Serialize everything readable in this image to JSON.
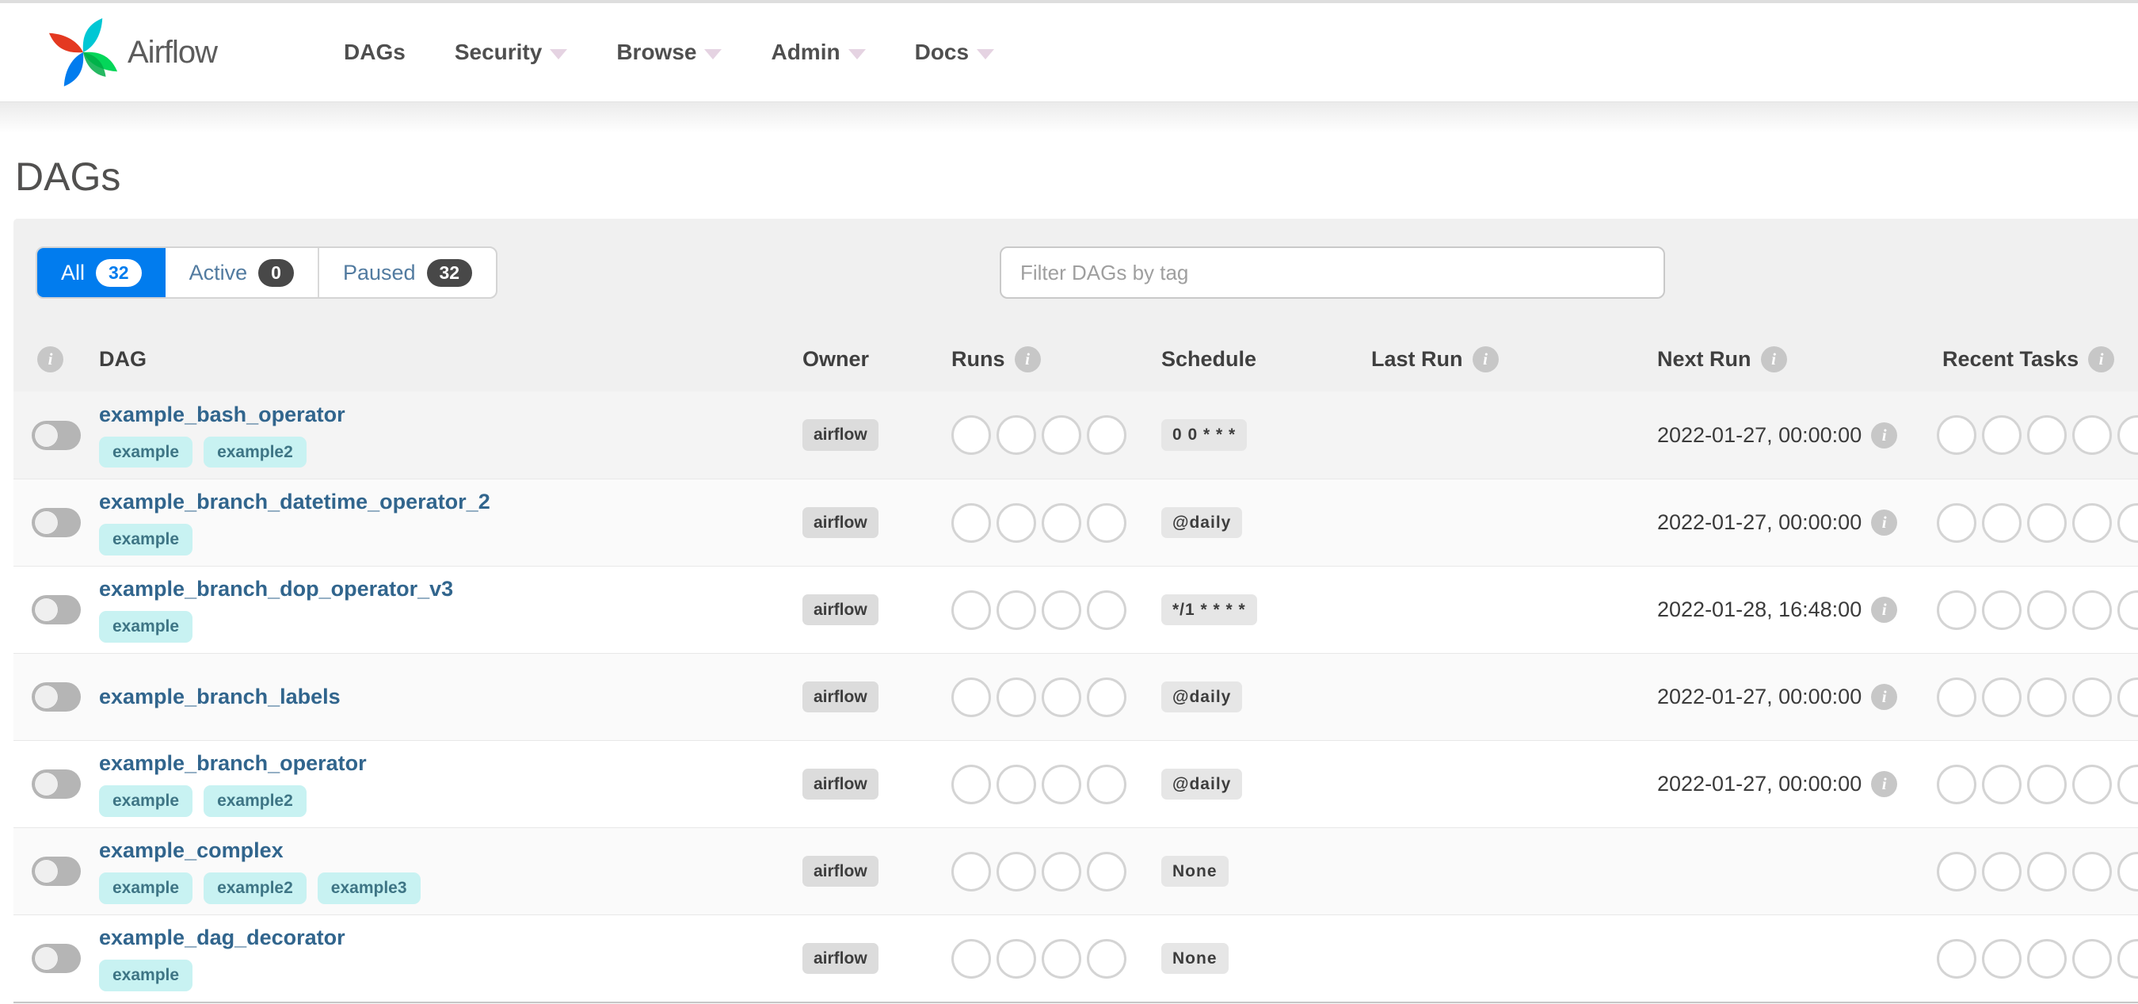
{
  "navbar": {
    "brand": "Airflow",
    "items": [
      {
        "label": "DAGs",
        "caret": false
      },
      {
        "label": "Security",
        "caret": true
      },
      {
        "label": "Browse",
        "caret": true
      },
      {
        "label": "Admin",
        "caret": true
      },
      {
        "label": "Docs",
        "caret": true
      }
    ]
  },
  "page": {
    "title": "DAGs"
  },
  "filters": {
    "tabs": [
      {
        "label": "All",
        "count": "32",
        "active": true
      },
      {
        "label": "Active",
        "count": "0",
        "active": false
      },
      {
        "label": "Paused",
        "count": "32",
        "active": false
      }
    ],
    "search_placeholder": "Filter DAGs by tag"
  },
  "colors": {
    "accent_blue": "#017cee",
    "link_blue": "#31658d",
    "tag_teal_bg": "#c8f2f2",
    "badge_gray_bg": "#dcdcdc"
  },
  "table": {
    "headers": {
      "dag": "DAG",
      "owner": "Owner",
      "runs": "Runs",
      "schedule": "Schedule",
      "last_run": "Last Run",
      "next_run": "Next Run",
      "recent_tasks": "Recent Tasks"
    },
    "runs_circle_count": 4,
    "recent_tasks_circle_count": 5,
    "rows": [
      {
        "name": "example_bash_operator",
        "tags": [
          "example",
          "example2"
        ],
        "owner": "airflow",
        "schedule": "0 0 * * *",
        "last_run": "",
        "next_run": "2022-01-27, 00:00:00"
      },
      {
        "name": "example_branch_datetime_operator_2",
        "tags": [
          "example"
        ],
        "owner": "airflow",
        "schedule": "@daily",
        "last_run": "",
        "next_run": "2022-01-27, 00:00:00"
      },
      {
        "name": "example_branch_dop_operator_v3",
        "tags": [
          "example"
        ],
        "owner": "airflow",
        "schedule": "*/1 * * * *",
        "last_run": "",
        "next_run": "2022-01-28, 16:48:00"
      },
      {
        "name": "example_branch_labels",
        "tags": [],
        "owner": "airflow",
        "schedule": "@daily",
        "last_run": "",
        "next_run": "2022-01-27, 00:00:00"
      },
      {
        "name": "example_branch_operator",
        "tags": [
          "example",
          "example2"
        ],
        "owner": "airflow",
        "schedule": "@daily",
        "last_run": "",
        "next_run": "2022-01-27, 00:00:00"
      },
      {
        "name": "example_complex",
        "tags": [
          "example",
          "example2",
          "example3"
        ],
        "owner": "airflow",
        "schedule": "None",
        "last_run": "",
        "next_run": ""
      },
      {
        "name": "example_dag_decorator",
        "tags": [
          "example"
        ],
        "owner": "airflow",
        "schedule": "None",
        "last_run": "",
        "next_run": ""
      }
    ]
  }
}
